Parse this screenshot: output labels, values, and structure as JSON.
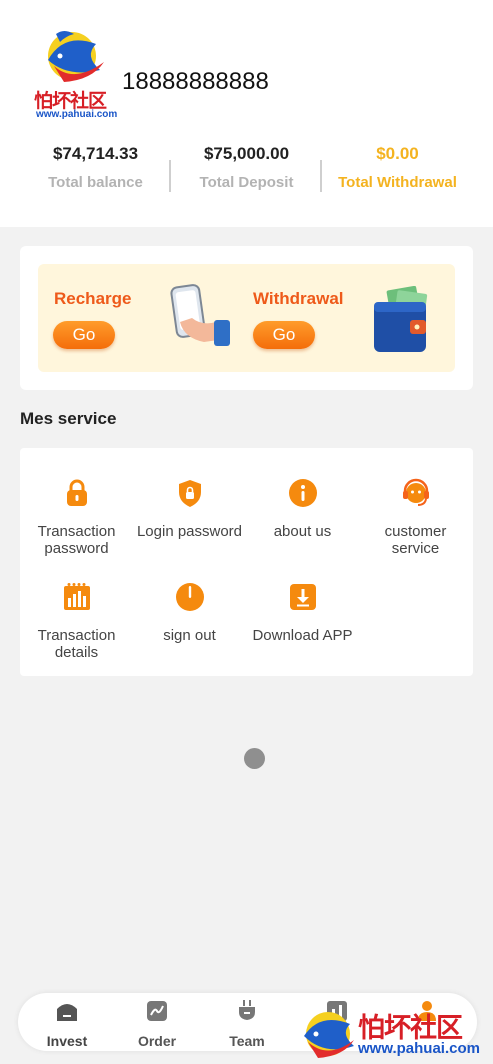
{
  "header": {
    "logo_text": "怕坏社区",
    "logo_url": "www.pahuai.com",
    "phone": "18888888888"
  },
  "stats": [
    {
      "value": "$74,714.33",
      "label": "Total balance"
    },
    {
      "value": "$75,000.00",
      "label": "Total Deposit"
    },
    {
      "value": "$0.00",
      "label": "Total Withdrawal"
    }
  ],
  "actions": {
    "recharge_label": "Recharge",
    "recharge_button": "Go",
    "withdrawal_label": "Withdrawal",
    "withdrawal_button": "Go"
  },
  "services_title": "Mes service",
  "services": [
    {
      "label": "Transaction password",
      "icon": "lock-icon"
    },
    {
      "label": "Login password",
      "icon": "shield-lock-icon"
    },
    {
      "label": "about us",
      "icon": "info-icon"
    },
    {
      "label": "customer service",
      "icon": "headset-icon"
    },
    {
      "label": "Transaction details",
      "icon": "bar-chart-icon"
    },
    {
      "label": "sign out",
      "icon": "power-icon"
    },
    {
      "label": "Download APP",
      "icon": "download-icon"
    }
  ],
  "tabs": [
    {
      "label": "Invest",
      "icon": "invest-icon"
    },
    {
      "label": "Order",
      "icon": "order-icon"
    },
    {
      "label": "Team",
      "icon": "team-icon"
    }
  ],
  "watermark": {
    "text": "怕坏社区",
    "url": "www.pahuai.com"
  },
  "colors": {
    "accent": "#f46d0a",
    "gold": "#f4b320",
    "recharge_title": "#ee5a1a",
    "watermark_red": "#d71f26",
    "watermark_blue": "#1a55c7"
  }
}
